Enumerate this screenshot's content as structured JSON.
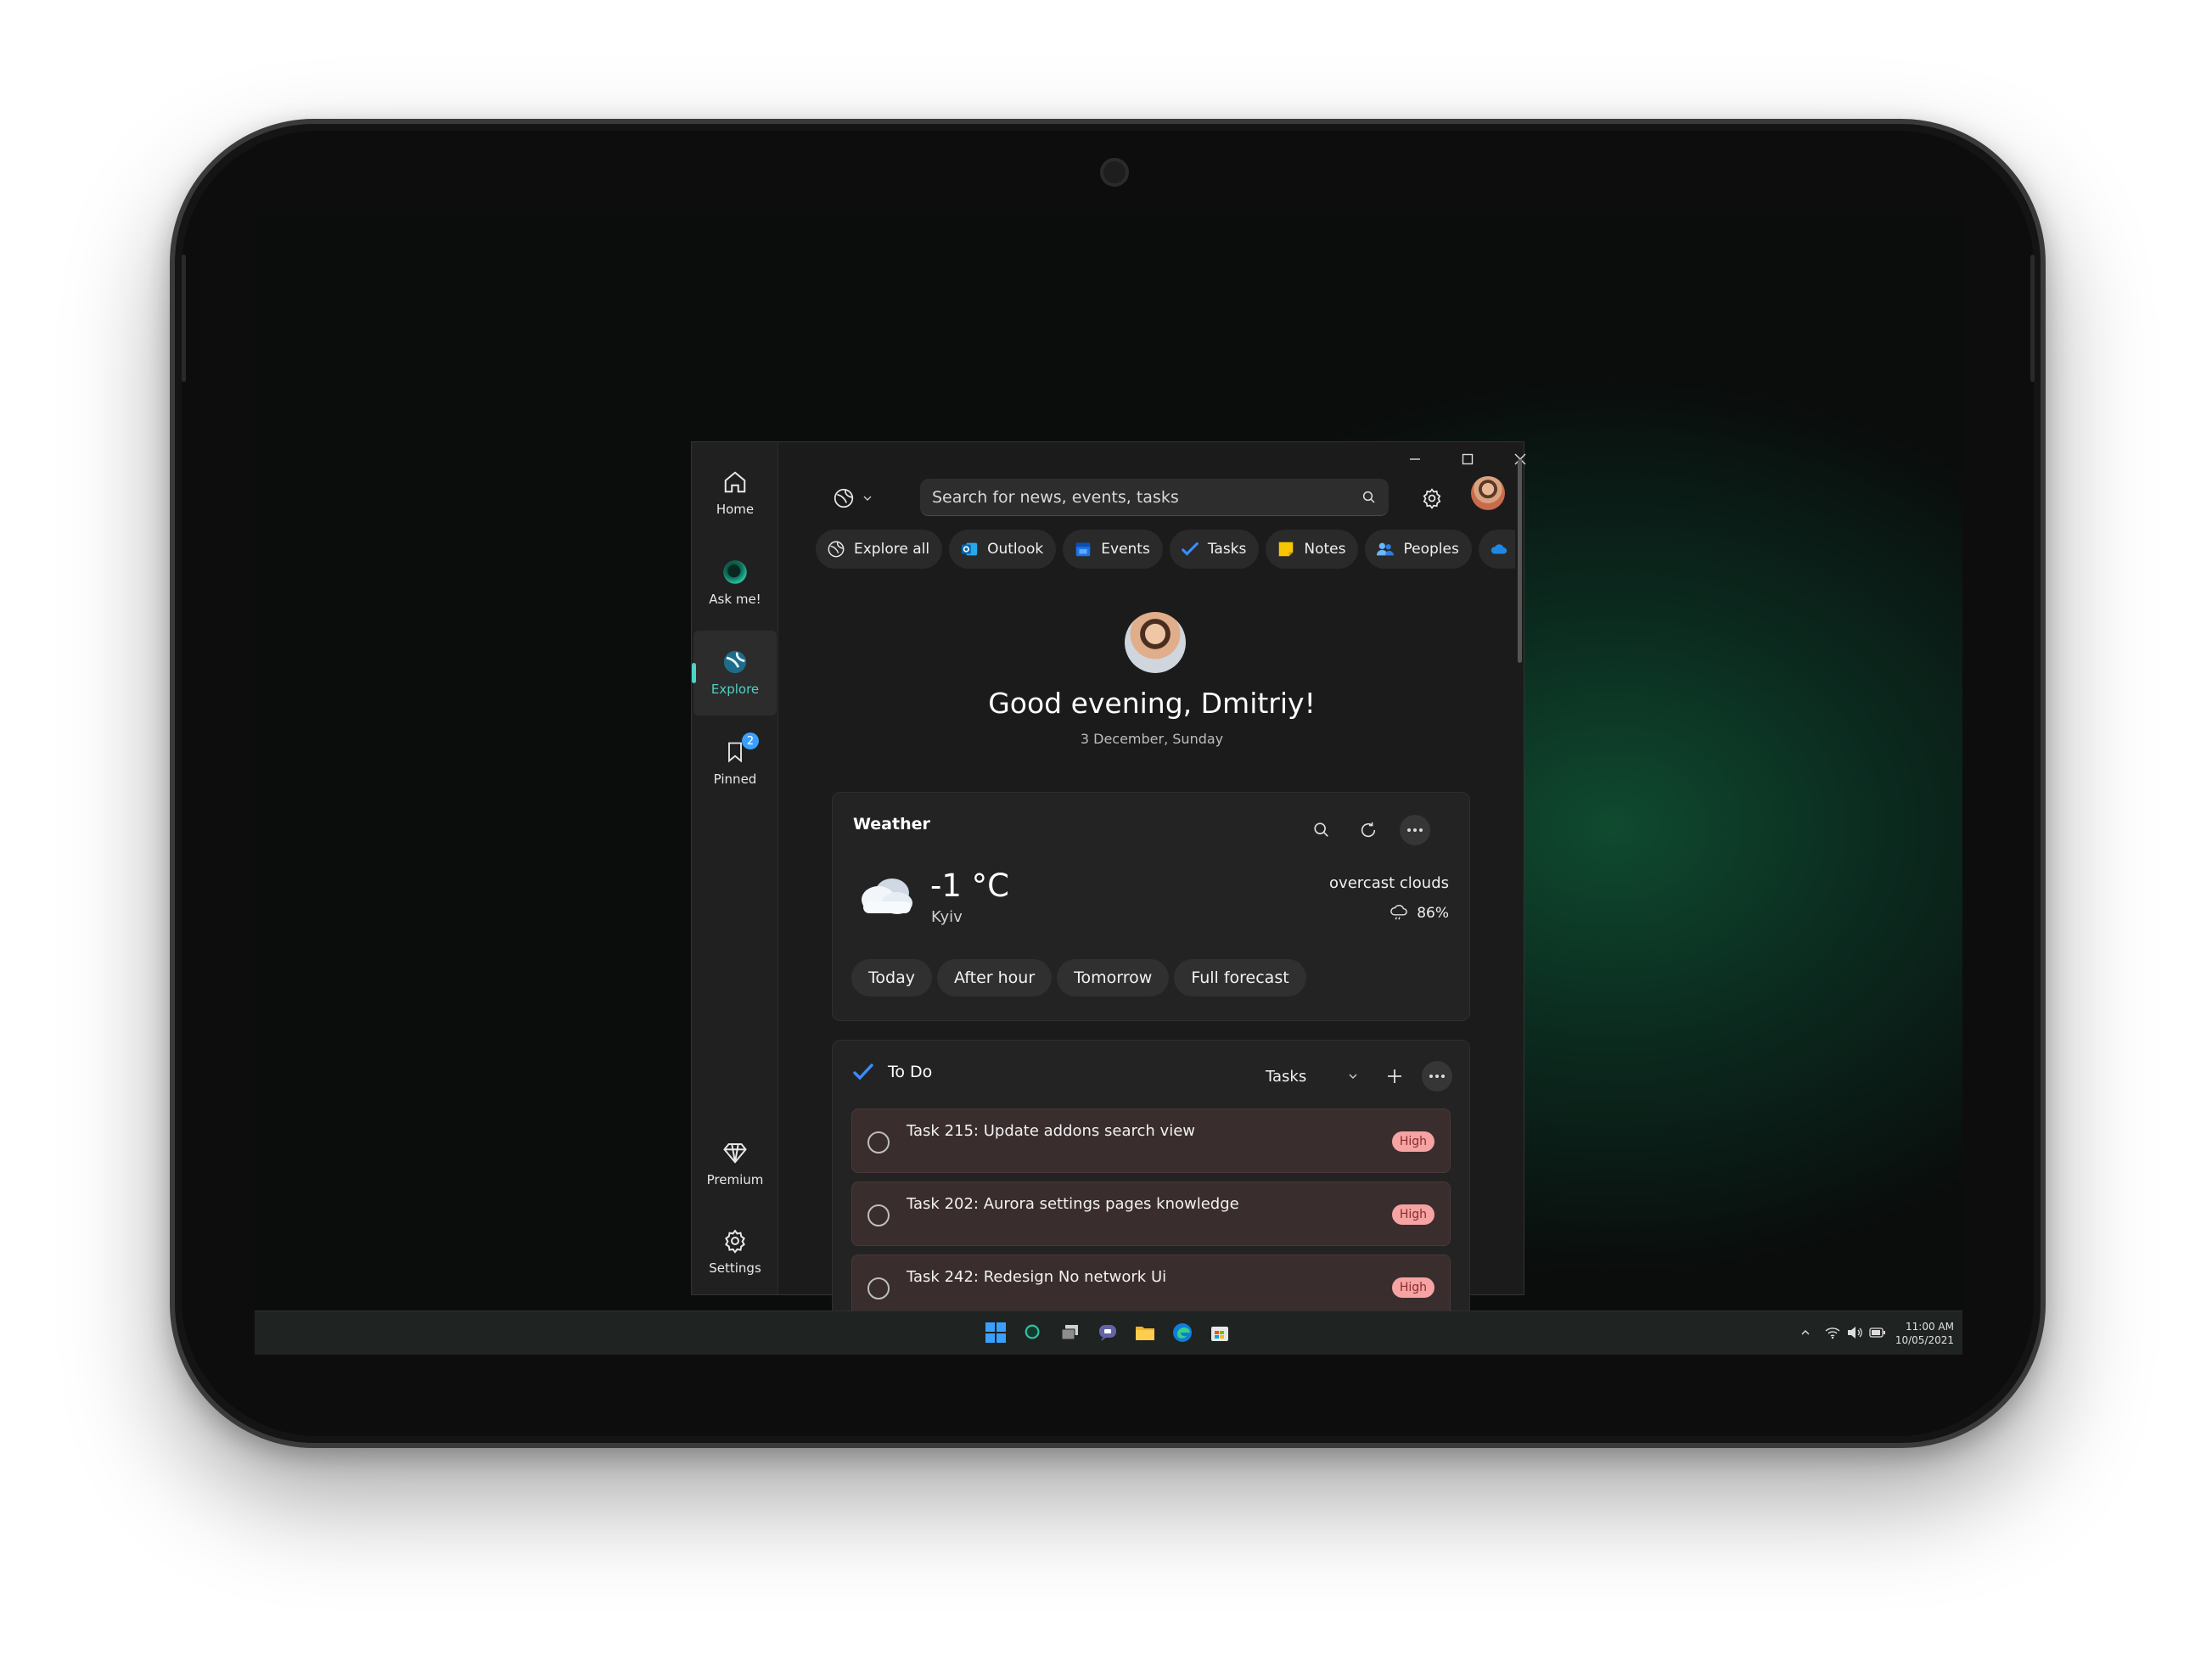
{
  "window": {
    "title_controls": {
      "minimize": "minimize",
      "maximize": "maximize",
      "close": "close"
    }
  },
  "sidenav": {
    "items": [
      {
        "label": "Home",
        "icon": "home-icon"
      },
      {
        "label": "Ask me!",
        "icon": "assistant-orb-icon"
      },
      {
        "label": "Explore",
        "icon": "explore-icon",
        "active": true
      },
      {
        "label": "Pinned",
        "icon": "bookmark-icon",
        "badge": "2"
      },
      {
        "label": "Premium",
        "icon": "diamond-icon"
      },
      {
        "label": "Settings",
        "icon": "gear-icon"
      }
    ]
  },
  "search": {
    "placeholder": "Search for news, events, tasks"
  },
  "chips": [
    {
      "label": "Explore all",
      "icon": "explore-icon"
    },
    {
      "label": "Outlook",
      "icon": "outlook-icon"
    },
    {
      "label": "Events",
      "icon": "calendar-icon"
    },
    {
      "label": "Tasks",
      "icon": "checkmark-icon"
    },
    {
      "label": "Notes",
      "icon": "sticky-note-icon"
    },
    {
      "label": "Peoples",
      "icon": "people-icon"
    }
  ],
  "greeting": {
    "text": "Good evening, Dmitriy!",
    "date": "3 December, Sunday"
  },
  "weather": {
    "title": "Weather",
    "temperature": "-1 °C",
    "city": "Kyiv",
    "condition": "overcast clouds",
    "humidity": "86%",
    "tabs": [
      "Today",
      "After hour",
      "Tomorrow",
      "Full forecast"
    ]
  },
  "todo": {
    "title": "To Do",
    "list_selector": "Tasks",
    "tasks": [
      {
        "text": "Task 215: Update addons search view",
        "priority": "High"
      },
      {
        "text": "Task 202: Aurora settings pages knowledge",
        "priority": "High"
      },
      {
        "text": "Task 242: Redesign No network Ui",
        "priority": "High"
      }
    ]
  },
  "taskbar": {
    "time": "11:00 AM",
    "date": "10/05/2021"
  },
  "colors": {
    "accent_teal": "#4fd1c5",
    "badge_blue": "#3aa0ff",
    "priority_high_bg": "#f5a3a3",
    "task_bg": "#3a2d2d"
  }
}
